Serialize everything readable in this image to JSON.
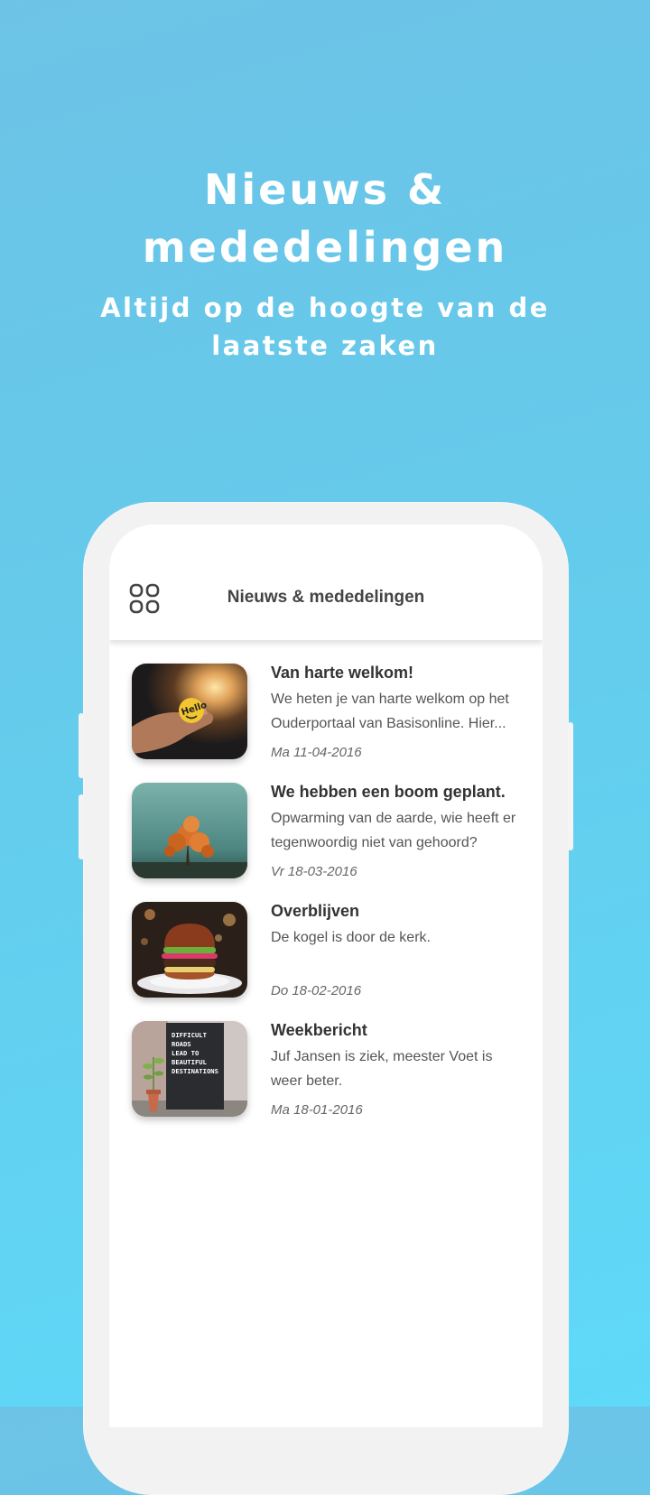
{
  "promo": {
    "title_line1": "Nieuws &",
    "title_line2": "mededelingen",
    "subtitle_line1": "Altijd op de hoogte van de",
    "subtitle_line2": "laatste zaken"
  },
  "header": {
    "menu_icon": "grid-menu-icon",
    "title": "Nieuws & mededelingen"
  },
  "news": [
    {
      "title": "Van harte welkom!",
      "excerpt_line1": "We heten je van harte welkom op het",
      "excerpt_line2": "Ouderportaal van Basisonline. Hier...",
      "date": "Ma 11-04-2016",
      "image": "hand-holding-hello-sticker-image"
    },
    {
      "title": "We hebben een boom geplant.",
      "excerpt_line1": "Opwarming van de aarde, wie heeft er",
      "excerpt_line2": "tegenwoordig niet van gehoord?",
      "date": "Vr 18-03-2016",
      "image": "orange-tree-image"
    },
    {
      "title": "Overblijven",
      "excerpt_line1": "De kogel is door de kerk.",
      "excerpt_line2": "",
      "date": "Do 18-02-2016",
      "image": "burger-image"
    },
    {
      "title": "Weekbericht",
      "excerpt_line1": "Juf Jansen is ziek, meester Voet is",
      "excerpt_line2": "weer beter.",
      "date": "Ma 18-01-2016",
      "image": "letterboard-plant-image",
      "image_text": [
        "DIFFICULT",
        "ROADS",
        "LEAD TO",
        "BEAUTIFUL",
        "DESTINATIONS"
      ]
    }
  ],
  "colors": {
    "background_top": "#6cc3e6",
    "background_bottom": "#5fd9f8",
    "header_text": "#444444",
    "item_title": "#333333"
  }
}
